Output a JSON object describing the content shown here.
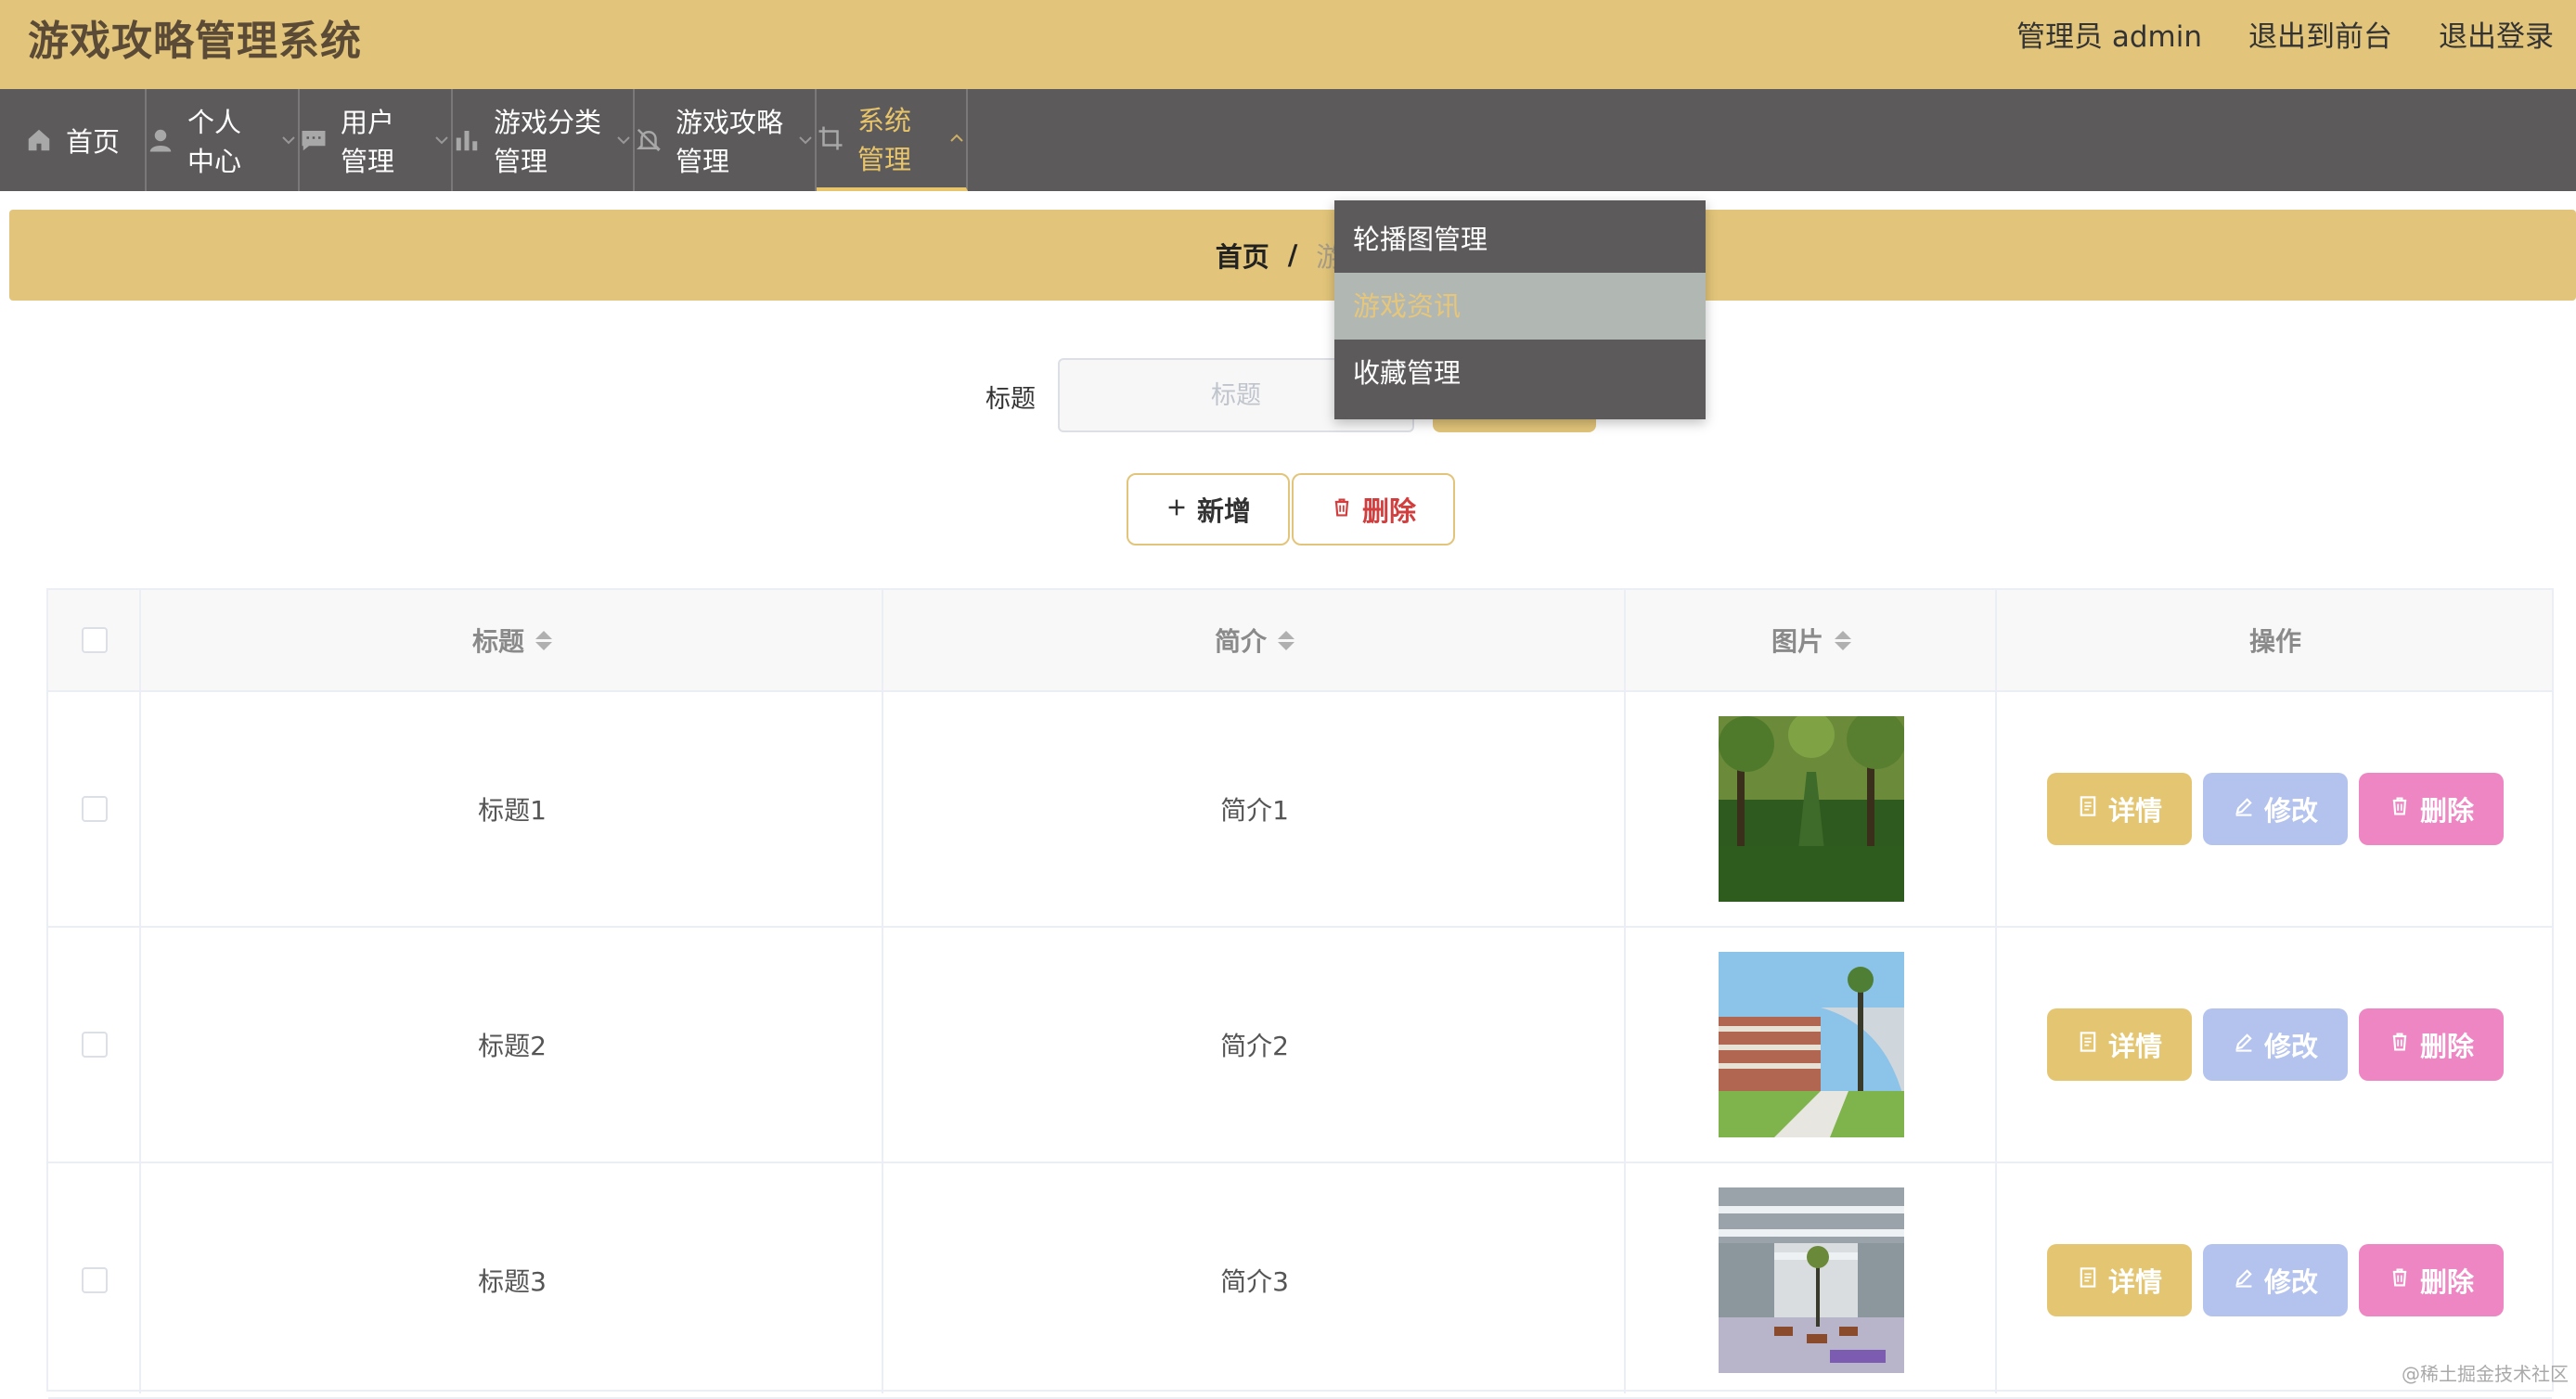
{
  "app": {
    "title": "游戏攻略管理系统"
  },
  "header": {
    "links": [
      "管理员 admin",
      "退出到前台",
      "退出登录"
    ]
  },
  "nav": {
    "items": [
      {
        "label": "首页",
        "icon": "home-icon"
      },
      {
        "label": "个人中心",
        "icon": "user-icon"
      },
      {
        "label": "用户管理",
        "icon": "chat-icon"
      },
      {
        "label": "游戏分类管理",
        "icon": "bar-chart-icon"
      },
      {
        "label": "游戏攻略管理",
        "icon": "bell-off-icon"
      },
      {
        "label": "系统管理",
        "icon": "crop-icon",
        "active": true
      }
    ]
  },
  "dropdown": {
    "items": [
      "轮播图管理",
      "游戏资讯",
      "收藏管理"
    ],
    "hovered_index": 1
  },
  "breadcrumb": {
    "home": "首页",
    "separator": "/",
    "current": "游戏"
  },
  "search": {
    "label": "标题",
    "placeholder": "标题",
    "value": ""
  },
  "toolbar": {
    "add_label": "新增",
    "delete_label": "删除"
  },
  "table": {
    "columns": [
      "标题",
      "简介",
      "图片",
      "操作"
    ],
    "rows": [
      {
        "title": "标题1",
        "intro": "简介1"
      },
      {
        "title": "标题2",
        "intro": "简介2"
      },
      {
        "title": "标题3",
        "intro": "简介3"
      }
    ],
    "actions": {
      "detail": "详情",
      "edit": "修改",
      "delete": "删除"
    }
  },
  "watermark": "@稀土掘金技术社区",
  "colors": {
    "header": "#e2c57a",
    "nav": "#5c5a5b",
    "accent": "#e8c46a",
    "detail": "#e4c672",
    "edit": "#b4c3ee",
    "delete": "#ee86c3",
    "danger": "#d23d3d"
  }
}
